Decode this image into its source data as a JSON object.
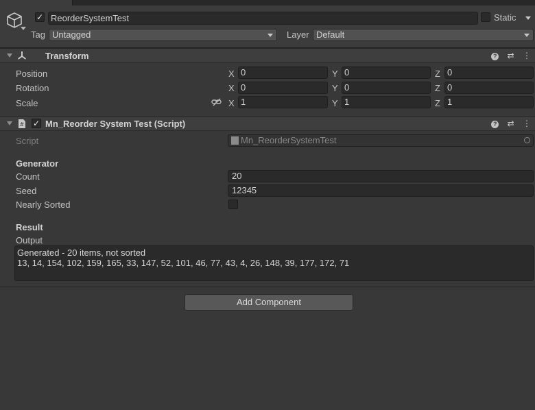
{
  "header": {
    "active": true,
    "name": "ReorderSystemTest",
    "static_label": "Static",
    "static_checked": false,
    "tag_label": "Tag",
    "tag_value": "Untagged",
    "layer_label": "Layer",
    "layer_value": "Default"
  },
  "transform": {
    "title": "Transform",
    "rows": [
      {
        "label": "Position",
        "x": "0",
        "y": "0",
        "z": "0"
      },
      {
        "label": "Rotation",
        "x": "0",
        "y": "0",
        "z": "0"
      },
      {
        "label": "Scale",
        "x": "1",
        "y": "1",
        "z": "1"
      }
    ],
    "axis_x": "X",
    "axis_y": "Y",
    "axis_z": "Z"
  },
  "script_component": {
    "title": "Mn_Reorder System Test (Script)",
    "enabled": true,
    "script_label": "Script",
    "script_value": "Mn_ReorderSystemTest",
    "generator_header": "Generator",
    "count_label": "Count",
    "count_value": "20",
    "seed_label": "Seed",
    "seed_value": "12345",
    "nearly_sorted_label": "Nearly Sorted",
    "nearly_sorted": false,
    "result_header": "Result",
    "output_label": "Output",
    "output_line1": "Generated - 20 items, not sorted",
    "output_line2": "13, 14, 154, 102, 159, 165, 33, 147, 52, 101, 46, 77, 43, 4, 26, 148, 39, 177, 172, 71"
  },
  "add_component_label": "Add Component"
}
